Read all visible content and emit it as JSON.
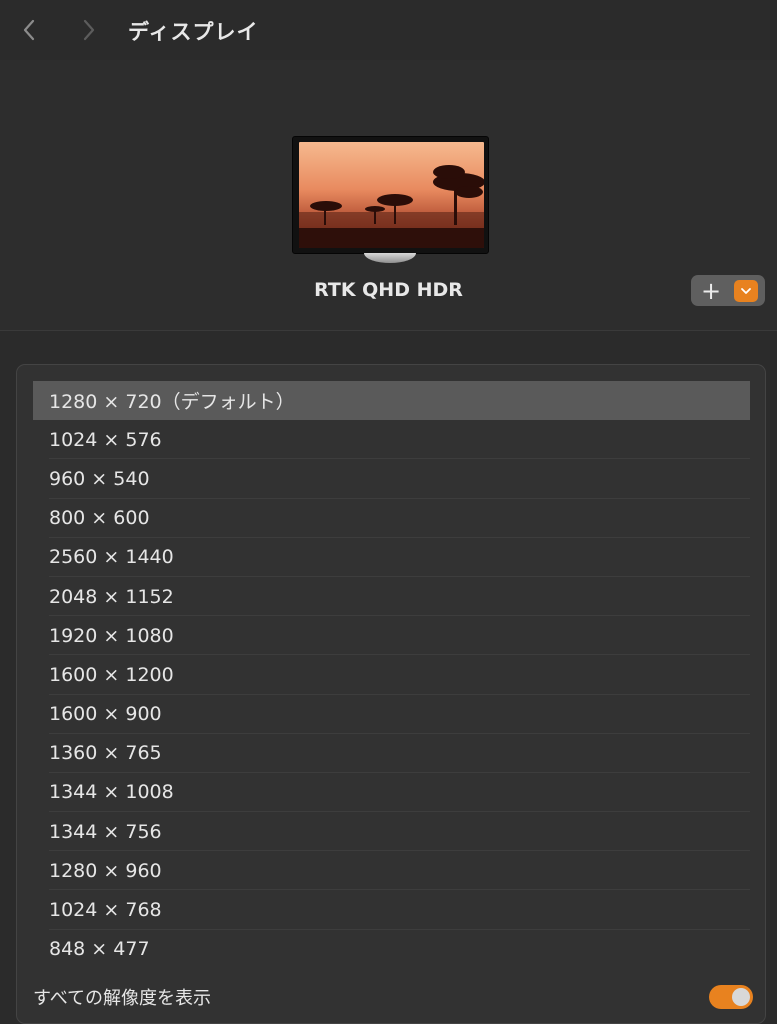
{
  "title": "ディスプレイ",
  "icons": {
    "back": "chevron-left-icon",
    "forward": "chevron-right-icon",
    "add": "plus-icon",
    "dropdown": "chevron-down-icon"
  },
  "display": {
    "name": "RTK QHD HDR"
  },
  "add_control": {
    "plus_label": "+"
  },
  "resolutions": {
    "selected_index": 0,
    "items": [
      "1280 × 720（デフォルト）",
      "1024 × 576",
      "960 × 540",
      "800 × 600",
      "2560 × 1440",
      "2048 × 1152",
      "1920 × 1080",
      "1600 × 1200",
      "1600 × 900",
      "1360 × 765",
      "1344 × 1008",
      "1344 × 756",
      "1280 × 960",
      "1024 × 768",
      "848 × 477"
    ]
  },
  "show_all": {
    "label": "すべての解像度を表示",
    "enabled": true
  },
  "colors": {
    "accent": "#e8821f",
    "background": "#2b2b2b",
    "panel": "#323232",
    "selected_row": "#5a5a5a"
  }
}
